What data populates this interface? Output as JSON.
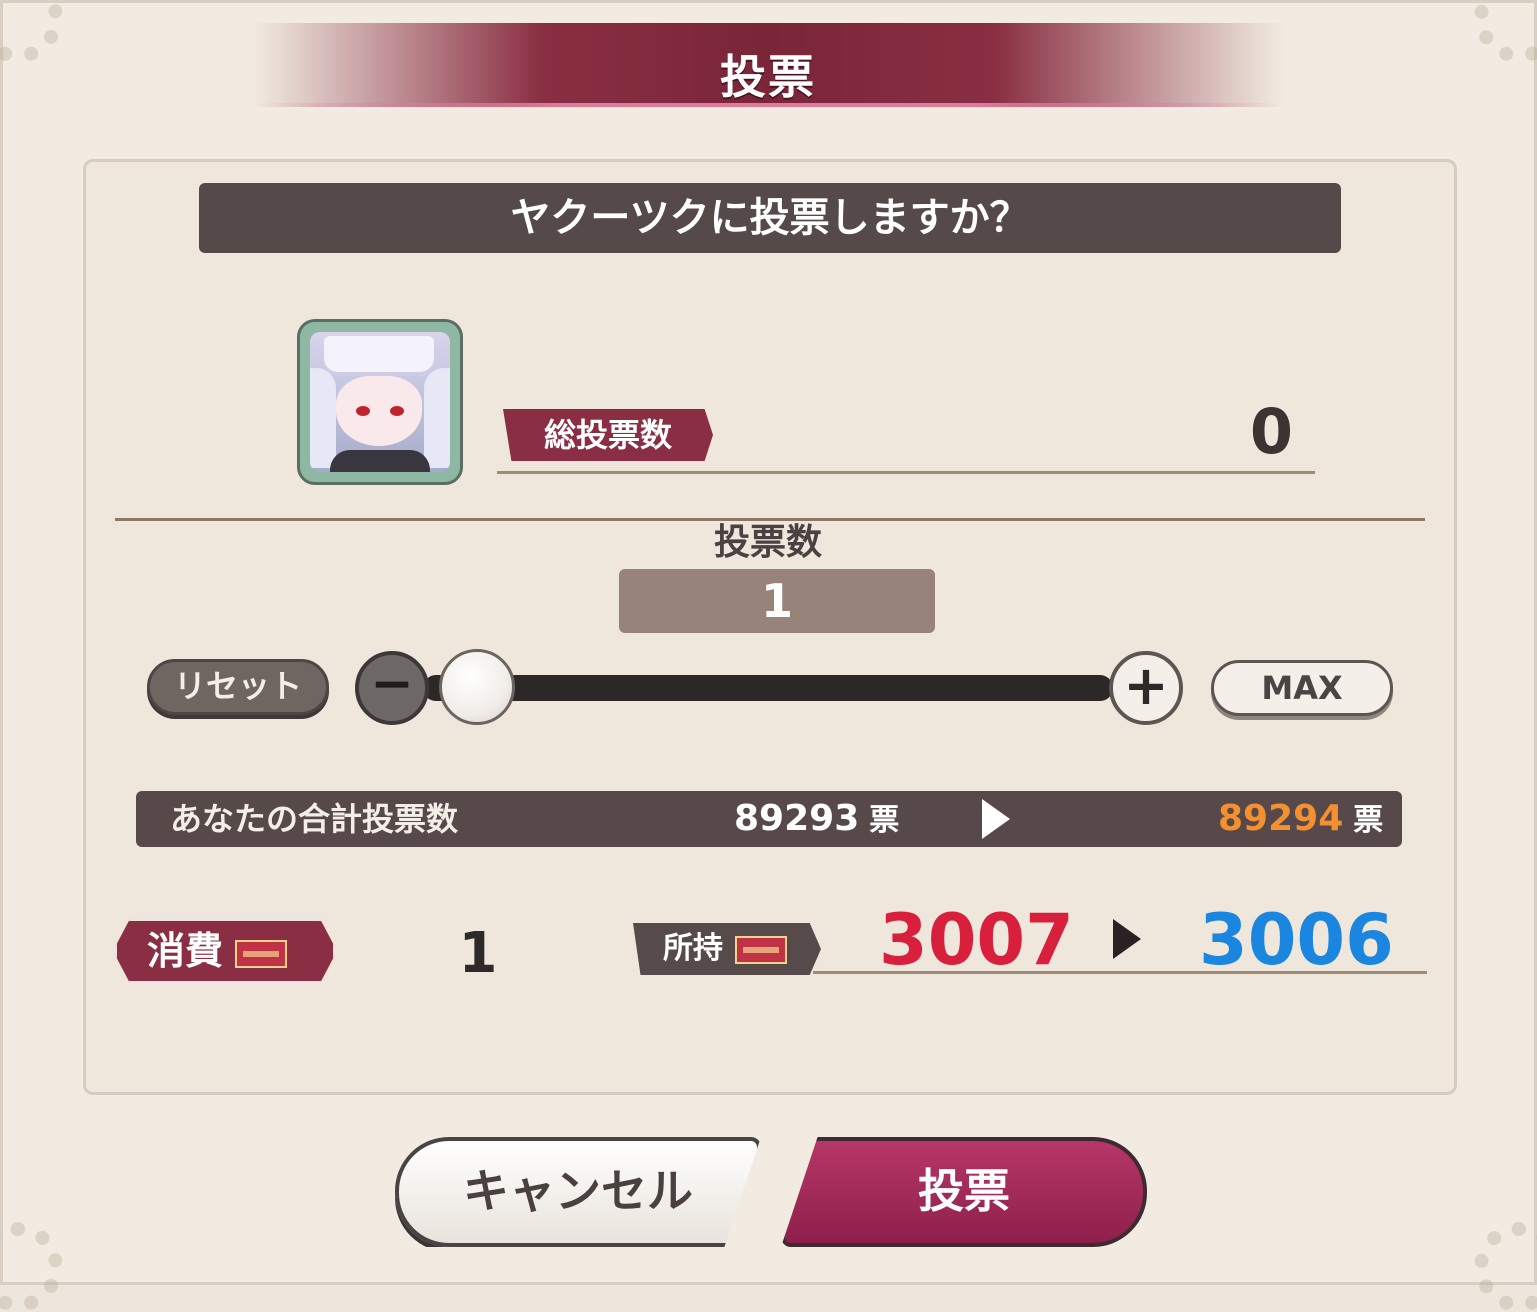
{
  "dialog": {
    "title": "投票",
    "question": "ヤクーツクに投票しますか？"
  },
  "character": {
    "portrait_icon": "character-portrait",
    "total_votes_label": "総投票数",
    "total_votes_value": "0"
  },
  "vote_amount": {
    "label": "投票数",
    "value": "1",
    "slider_fraction": 0,
    "reset_label": "リセット",
    "minus_symbol": "−",
    "plus_symbol": "+",
    "max_label": "MAX"
  },
  "your_total": {
    "label": "あなたの合計投票数",
    "before": "89293",
    "after": "89294",
    "unit": "票"
  },
  "consume": {
    "label": "消費",
    "value": "1"
  },
  "owned": {
    "label": "所持",
    "before": "3007",
    "after": "3006"
  },
  "buttons": {
    "cancel": "キャンセル",
    "vote": "投票"
  },
  "colors": {
    "accent": "#8a2f43",
    "after_total": "#f49030",
    "owned_before": "#d8203d",
    "owned_after": "#1a86e0"
  }
}
